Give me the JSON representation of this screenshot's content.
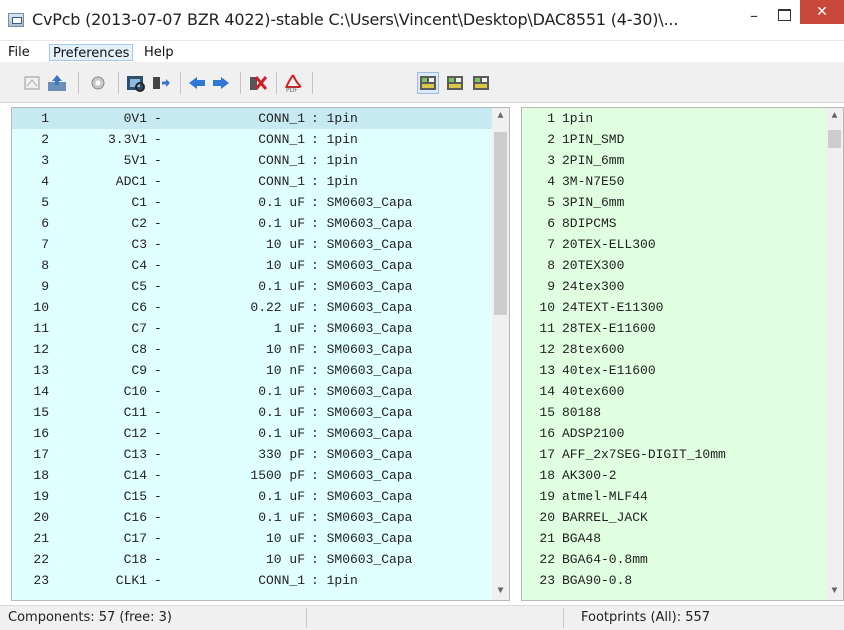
{
  "window": {
    "title": "CvPcb (2013-07-07 BZR 4022)-stable C:\\Users\\Vincent\\Desktop\\DAC8551 (4-30)\\...",
    "minimize": "–",
    "close": "✕"
  },
  "menu": [
    "File",
    "Preferences",
    "Help"
  ],
  "toolbar": {
    "icons": [
      "select-footprint-editor-icon",
      "save-icon",
      "config-icon",
      "view-footprint-icon",
      "auto-associate-icon",
      "previous-icon",
      "next-icon",
      "delete-associations-icon",
      "pdf-datasheet-icon",
      "filter-keywords-icon",
      "filter-pin-count-icon",
      "filter-library-icon"
    ]
  },
  "components": [
    {
      "num": "1",
      "ref": "0V1",
      "value": "CONN_1",
      "footprint": "1pin"
    },
    {
      "num": "2",
      "ref": "3.3V1",
      "value": "CONN_1",
      "footprint": "1pin"
    },
    {
      "num": "3",
      "ref": "5V1",
      "value": "CONN_1",
      "footprint": "1pin"
    },
    {
      "num": "4",
      "ref": "ADC1",
      "value": "CONN_1",
      "footprint": "1pin"
    },
    {
      "num": "5",
      "ref": "C1",
      "value": "0.1 uF",
      "footprint": "SM0603_Capa"
    },
    {
      "num": "6",
      "ref": "C2",
      "value": "0.1 uF",
      "footprint": "SM0603_Capa"
    },
    {
      "num": "7",
      "ref": "C3",
      "value": "10 uF",
      "footprint": "SM0603_Capa"
    },
    {
      "num": "8",
      "ref": "C4",
      "value": "10 uF",
      "footprint": "SM0603_Capa"
    },
    {
      "num": "9",
      "ref": "C5",
      "value": "0.1 uF",
      "footprint": "SM0603_Capa"
    },
    {
      "num": "10",
      "ref": "C6",
      "value": "0.22 uF",
      "footprint": "SM0603_Capa"
    },
    {
      "num": "11",
      "ref": "C7",
      "value": "1 uF",
      "footprint": "SM0603_Capa"
    },
    {
      "num": "12",
      "ref": "C8",
      "value": "10 nF",
      "footprint": "SM0603_Capa"
    },
    {
      "num": "13",
      "ref": "C9",
      "value": "10 nF",
      "footprint": "SM0603_Capa"
    },
    {
      "num": "14",
      "ref": "C10",
      "value": "0.1 uF",
      "footprint": "SM0603_Capa"
    },
    {
      "num": "15",
      "ref": "C11",
      "value": "0.1 uF",
      "footprint": "SM0603_Capa"
    },
    {
      "num": "16",
      "ref": "C12",
      "value": "0.1 uF",
      "footprint": "SM0603_Capa"
    },
    {
      "num": "17",
      "ref": "C13",
      "value": "330 pF",
      "footprint": "SM0603_Capa"
    },
    {
      "num": "18",
      "ref": "C14",
      "value": "1500 pF",
      "footprint": "SM0603_Capa"
    },
    {
      "num": "19",
      "ref": "C15",
      "value": "0.1 uF",
      "footprint": "SM0603_Capa"
    },
    {
      "num": "20",
      "ref": "C16",
      "value": "0.1 uF",
      "footprint": "SM0603_Capa"
    },
    {
      "num": "21",
      "ref": "C17",
      "value": "10 uF",
      "footprint": "SM0603_Capa"
    },
    {
      "num": "22",
      "ref": "C18",
      "value": "10 uF",
      "footprint": "SM0603_Capa"
    },
    {
      "num": "23",
      "ref": "CLK1",
      "value": "CONN_1",
      "footprint": "1pin"
    }
  ],
  "footprints": [
    {
      "num": "1",
      "name": "1pin"
    },
    {
      "num": "2",
      "name": "1PIN_SMD"
    },
    {
      "num": "3",
      "name": "2PIN_6mm"
    },
    {
      "num": "4",
      "name": "3M-N7E50"
    },
    {
      "num": "5",
      "name": "3PIN_6mm"
    },
    {
      "num": "6",
      "name": "8DIPCMS"
    },
    {
      "num": "7",
      "name": "20TEX-ELL300"
    },
    {
      "num": "8",
      "name": "20TEX300"
    },
    {
      "num": "9",
      "name": "24tex300"
    },
    {
      "num": "10",
      "name": "24TEXT-E11300"
    },
    {
      "num": "11",
      "name": "28TEX-E11600"
    },
    {
      "num": "12",
      "name": "28tex600"
    },
    {
      "num": "13",
      "name": "40tex-E11600"
    },
    {
      "num": "14",
      "name": "40tex600"
    },
    {
      "num": "15",
      "name": "80188"
    },
    {
      "num": "16",
      "name": "ADSP2100"
    },
    {
      "num": "17",
      "name": "AFF_2x7SEG-DIGIT_10mm"
    },
    {
      "num": "18",
      "name": "AK300-2"
    },
    {
      "num": "19",
      "name": "atmel-MLF44"
    },
    {
      "num": "20",
      "name": "BARREL_JACK"
    },
    {
      "num": "21",
      "name": "BGA48"
    },
    {
      "num": "22",
      "name": "BGA64-0.8mm"
    },
    {
      "num": "23",
      "name": "BGA90-0.8"
    }
  ],
  "scrollbars": {
    "left_thumb_fraction": 0.4,
    "right_thumb_fraction": 0.04
  },
  "status": {
    "components": "Components: 57 (free: 3)",
    "footprints": "Footprints (All): 557"
  }
}
